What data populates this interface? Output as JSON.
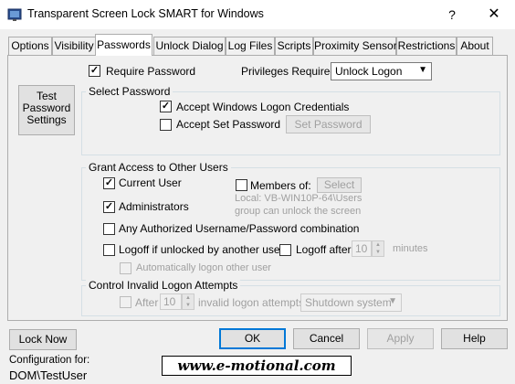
{
  "window": {
    "title": "Transparent Screen Lock SMART for Windows",
    "help": "?",
    "close": "✕"
  },
  "tabs": [
    {
      "label": "Options"
    },
    {
      "label": "Visibility"
    },
    {
      "label": "Passwords",
      "active": true
    },
    {
      "label": "Unlock Dialog"
    },
    {
      "label": "Log Files"
    },
    {
      "label": "Scripts"
    },
    {
      "label": "Proximity Sensor"
    },
    {
      "label": "Restrictions"
    },
    {
      "label": "About"
    }
  ],
  "passwords": {
    "require_password": {
      "label": "Require Password",
      "checked": true
    },
    "privileges": {
      "label": "Privileges Required",
      "value": "Unlock Logon"
    },
    "test_button": {
      "line1": "Test",
      "line2": "Password",
      "line3": "Settings"
    },
    "select_password": {
      "title": "Select Password",
      "accept_windows": {
        "label": "Accept Windows Logon Credentials",
        "checked": true
      },
      "accept_set": {
        "label": "Accept Set Password",
        "checked": false
      },
      "set_password_button": "Set Password"
    },
    "grant_access": {
      "title": "Grant Access to Other Users",
      "current_user": {
        "label": "Current User",
        "checked": true
      },
      "administrators": {
        "label": "Administrators",
        "checked": true
      },
      "members_of": {
        "label": "Members of:",
        "checked": false
      },
      "select_button": "Select",
      "group_info_line1": "Local: VB-WIN10P-64\\Users",
      "group_info_line2": "group can unlock the screen",
      "any_authorized": {
        "label": "Any Authorized Username/Password combination",
        "checked": false
      },
      "logoff_other": {
        "label": "Logoff if unlocked by another user",
        "checked": false
      },
      "logoff_after": {
        "label": "Logoff after",
        "checked": false,
        "value": "10",
        "unit": "minutes"
      },
      "auto_logon": {
        "label": "Automatically logon other user",
        "checked": false
      }
    },
    "invalid_attempts": {
      "title": "Control Invalid Logon Attempts",
      "after": {
        "label": "After",
        "checked": false,
        "value": "10",
        "suffix": "invalid logon attempts"
      },
      "action": "Shutdown system"
    }
  },
  "footer": {
    "lock_now": "Lock Now",
    "ok": "OK",
    "cancel": "Cancel",
    "apply": "Apply",
    "help": "Help",
    "config_label": "Configuration for:",
    "config_user": "DOM\\TestUser",
    "logo": "www.e-motional.com"
  },
  "colors": {
    "accent": "#0078d7",
    "disabled_text": "#a0a0a0",
    "panel": "#f0f0f0"
  }
}
